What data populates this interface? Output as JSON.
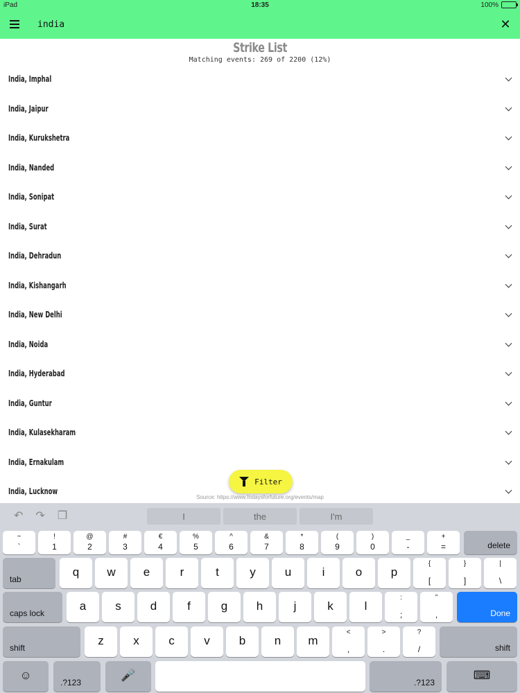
{
  "status_bar": {
    "device": "iPad",
    "time": "18:35",
    "battery": "100%"
  },
  "app_bar": {
    "search_value": "india"
  },
  "header": {
    "title": "Strike List",
    "subtitle": "Matching events: 269 of 2200 (12%)"
  },
  "list": [
    "India, Imphal",
    "India, Jaipur",
    "India, Kurukshetra",
    "India, Nanded",
    "India, Sonipat",
    "India, Surat",
    "India, Dehradun",
    "India, Kishangarh",
    "India, New Delhi",
    "India, Noida",
    "India, Hyderabad",
    "India, Guntur",
    "India, Kulasekharam",
    "India, Ernakulam",
    "India, Lucknow"
  ],
  "filter": {
    "label": "Filter"
  },
  "source": "Source: https://www.fridaysforfuture.org/events/map",
  "keyboard": {
    "suggestions": [
      "I",
      "the",
      "I'm"
    ],
    "number_row": [
      {
        "top": "~",
        "bot": "`"
      },
      {
        "top": "!",
        "bot": "1"
      },
      {
        "top": "@",
        "bot": "2"
      },
      {
        "top": "#",
        "bot": "3"
      },
      {
        "top": "€",
        "bot": "4"
      },
      {
        "top": "%",
        "bot": "5"
      },
      {
        "top": "^",
        "bot": "6"
      },
      {
        "top": "&",
        "bot": "7"
      },
      {
        "top": "*",
        "bot": "8"
      },
      {
        "top": "(",
        "bot": "9"
      },
      {
        "top": ")",
        "bot": "0"
      },
      {
        "top": "_",
        "bot": "-"
      },
      {
        "top": "+",
        "bot": "="
      }
    ],
    "delete": "delete",
    "tab": "tab",
    "row1": [
      "q",
      "w",
      "e",
      "r",
      "t",
      "y",
      "u",
      "i",
      "o",
      "p"
    ],
    "row1_extra": [
      {
        "top": "{",
        "bot": "["
      },
      {
        "top": "}",
        "bot": "]"
      },
      {
        "top": "|",
        "bot": "\\"
      }
    ],
    "caps": "caps lock",
    "row2": [
      "a",
      "s",
      "d",
      "f",
      "g",
      "h",
      "j",
      "k",
      "l"
    ],
    "row2_extra": [
      {
        "top": ":",
        "bot": ";"
      },
      {
        "top": "”",
        "bot": ","
      }
    ],
    "done": "Done",
    "shift": "shift",
    "row3": [
      "z",
      "x",
      "c",
      "v",
      "b",
      "n",
      "m"
    ],
    "row3_extra": [
      {
        "top": "<",
        "bot": ","
      },
      {
        "top": ">",
        "bot": "."
      },
      {
        "top": "?",
        "bot": "/"
      }
    ],
    "numbers_key": ".?123",
    "emoji_icon": "emoji-icon",
    "mic_icon": "microphone-icon",
    "hide_icon": "keyboard-hide-icon"
  }
}
